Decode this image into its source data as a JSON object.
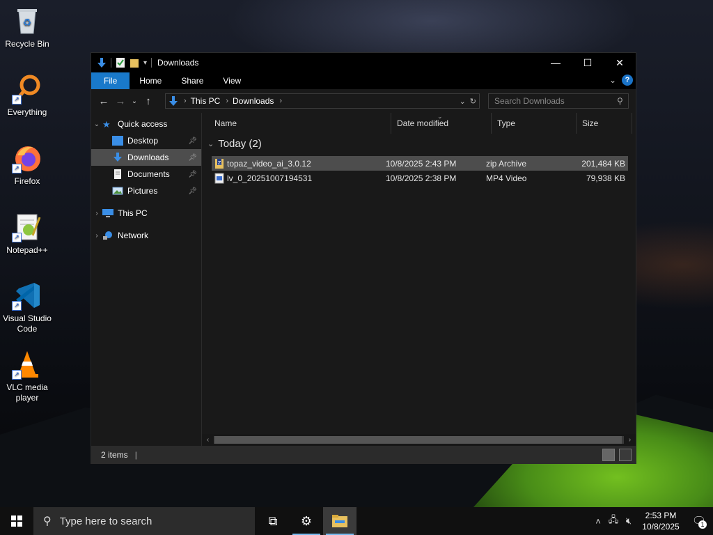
{
  "desktop": {
    "icons": [
      {
        "label": "Recycle Bin"
      },
      {
        "label": "Everything"
      },
      {
        "label": "Firefox"
      },
      {
        "label": "Notepad++"
      },
      {
        "label": "Visual Studio Code"
      },
      {
        "label": "VLC media player"
      }
    ]
  },
  "window": {
    "title": "Downloads",
    "ribbon_tabs": {
      "file": "File",
      "home": "Home",
      "share": "Share",
      "view": "View"
    },
    "help": "?",
    "address": {
      "this_pc": "This PC",
      "downloads": "Downloads"
    },
    "search_placeholder": "Search Downloads",
    "nav": {
      "quick_access": "Quick access",
      "desktop": "Desktop",
      "downloads": "Downloads",
      "documents": "Documents",
      "pictures": "Pictures",
      "this_pc": "This PC",
      "network": "Network"
    },
    "columns": {
      "name": "Name",
      "date": "Date modified",
      "type": "Type",
      "size": "Size"
    },
    "group": "Today (2)",
    "files": [
      {
        "name": "topaz_video_ai_3.0.12",
        "date": "10/8/2025 2:43 PM",
        "type": "zip Archive",
        "size": "201,484 KB"
      },
      {
        "name": "lv_0_20251007194531",
        "date": "10/8/2025 2:38 PM",
        "type": "MP4 Video",
        "size": "79,938 KB"
      }
    ],
    "status": "2 items"
  },
  "taskbar": {
    "search_placeholder": "Type here to search",
    "time": "2:53 PM",
    "date": "10/8/2025",
    "notif_count": "1"
  },
  "colors": {
    "accent": "#1979ca",
    "selection": "#4d4d4d",
    "folder": "#e8c15f",
    "download_arrow": "#3a8ee6"
  }
}
